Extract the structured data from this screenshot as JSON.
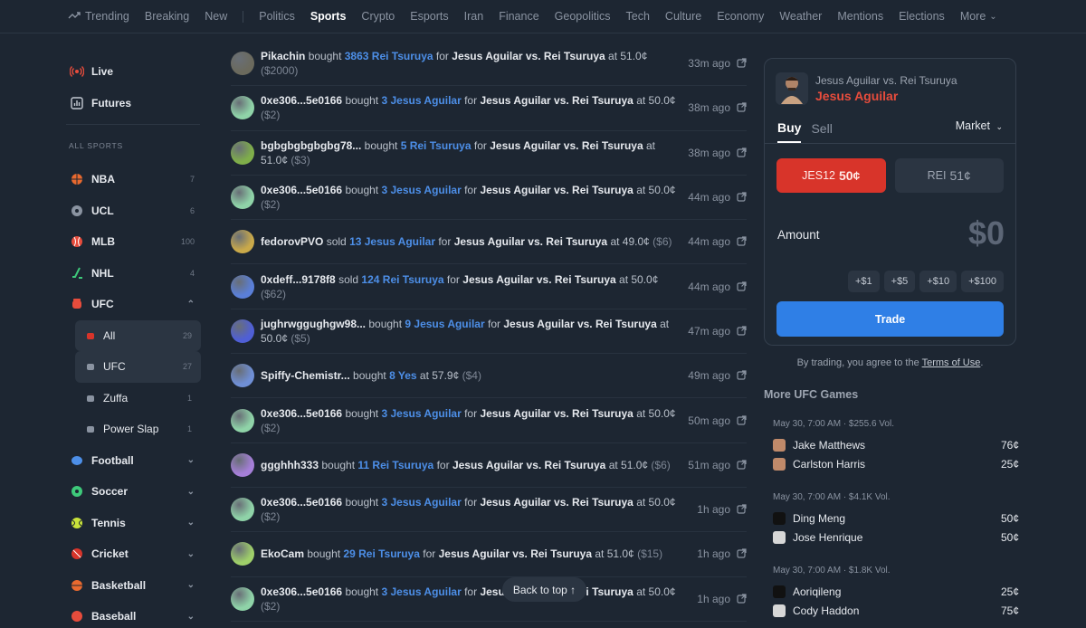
{
  "topnav": {
    "items": [
      "Trending",
      "Breaking",
      "New",
      "Politics",
      "Sports",
      "Crypto",
      "Esports",
      "Iran",
      "Finance",
      "Geopolitics",
      "Tech",
      "Culture",
      "Economy",
      "Weather",
      "Mentions",
      "Elections",
      "More"
    ],
    "active": "Sports"
  },
  "sidebar": {
    "live": "Live",
    "futures": "Futures",
    "heading": "ALL SPORTS",
    "sports": [
      {
        "label": "NBA",
        "count": "7"
      },
      {
        "label": "UCL",
        "count": "6"
      },
      {
        "label": "MLB",
        "count": "100"
      },
      {
        "label": "NHL",
        "count": "4"
      },
      {
        "label": "UFC"
      }
    ],
    "ufc_sub": [
      {
        "label": "All",
        "count": "29"
      },
      {
        "label": "UFC",
        "count": "27"
      },
      {
        "label": "Zuffa",
        "count": "1"
      },
      {
        "label": "Power Slap",
        "count": "1"
      }
    ],
    "more_sports": [
      "Football",
      "Soccer",
      "Tennis",
      "Cricket",
      "Basketball",
      "Baseball"
    ]
  },
  "activity": [
    {
      "user": "Pikachin",
      "verb": "bought",
      "qty": "3863 Rei Tsuruya",
      "mid": "for",
      "market": "Jesus Aguilar vs. Rei Tsuruya",
      "price": "at 51.0¢",
      "amount": "($2000)",
      "time": "33m ago",
      "avatar": "#6b6a5d"
    },
    {
      "user": "0xe306...5e0166",
      "verb": "bought",
      "qty": "3 Jesus Aguilar",
      "mid": "for",
      "market": "Jesus Aguilar vs. Rei Tsuruya",
      "price": "at 50.0¢",
      "amount": "($2)",
      "time": "38m ago",
      "avatar": "#8fd3a8"
    },
    {
      "user": "bgbgbgbgbgbg78...",
      "verb": "bought",
      "qty": "5 Rei Tsuruya",
      "mid": "for",
      "market": "Jesus Aguilar vs. Rei Tsuruya",
      "price": "at 51.0¢",
      "amount": "($3)",
      "time": "38m ago",
      "avatar": "#7fae4a"
    },
    {
      "user": "0xe306...5e0166",
      "verb": "bought",
      "qty": "3 Jesus Aguilar",
      "mid": "for",
      "market": "Jesus Aguilar vs. Rei Tsuruya",
      "price": "at 50.0¢",
      "amount": "($2)",
      "time": "44m ago",
      "avatar": "#8fd3a8"
    },
    {
      "user": "fedorovPVO",
      "verb": "sold",
      "qty": "13 Jesus Aguilar",
      "mid": "for",
      "market": "Jesus Aguilar vs. Rei Tsuruya",
      "price": "at 49.0¢",
      "amount": "($6)",
      "time": "44m ago",
      "avatar": "#c9a94a"
    },
    {
      "user": "0xdeff...9178f8",
      "verb": "sold",
      "qty": "124 Rei Tsuruya",
      "mid": "for",
      "market": "Jesus Aguilar vs. Rei Tsuruya",
      "price": "at 50.0¢",
      "amount": "($62)",
      "time": "44m ago",
      "avatar": "#5a7fd8"
    },
    {
      "user": "jughrwggughgw98...",
      "verb": "bought",
      "qty": "9 Jesus Aguilar",
      "mid": "for",
      "market": "Jesus Aguilar vs. Rei Tsuruya",
      "price": "at 50.0¢",
      "amount": "($5)",
      "time": "47m ago",
      "avatar": "#4f5fd6"
    },
    {
      "user": "Spiffy-Chemistr...",
      "verb": "bought",
      "qty": "8 Yes",
      "mid": "",
      "market": "",
      "price": "at 57.9¢",
      "amount": "($4)",
      "time": "49m ago",
      "avatar": "#6f8fd6"
    },
    {
      "user": "0xe306...5e0166",
      "verb": "bought",
      "qty": "3 Jesus Aguilar",
      "mid": "for",
      "market": "Jesus Aguilar vs. Rei Tsuruya",
      "price": "at 50.0¢",
      "amount": "($2)",
      "time": "50m ago",
      "avatar": "#8fd3a8"
    },
    {
      "user": "ggghhh333",
      "verb": "bought",
      "qty": "11 Rei Tsuruya",
      "mid": "for",
      "market": "Jesus Aguilar vs. Rei Tsuruya",
      "price": "at 51.0¢",
      "amount": "($6)",
      "time": "51m ago",
      "avatar": "#a57fd8"
    },
    {
      "user": "0xe306...5e0166",
      "verb": "bought",
      "qty": "3 Jesus Aguilar",
      "mid": "for",
      "market": "Jesus Aguilar vs. Rei Tsuruya",
      "price": "at 50.0¢",
      "amount": "($2)",
      "time": "1h ago",
      "avatar": "#8fd3a8"
    },
    {
      "user": "EkoCam",
      "verb": "bought",
      "qty": "29 Rei Tsuruya",
      "mid": "for",
      "market": "Jesus Aguilar vs. Rei Tsuruya",
      "price": "at 51.0¢",
      "amount": "($15)",
      "time": "1h ago",
      "avatar": "#9fcf6a"
    },
    {
      "user": "0xe306...5e0166",
      "verb": "bought",
      "qty": "3 Jesus Aguilar",
      "mid": "for",
      "market": "Jesus Aguilar vs. Rei Tsuruya",
      "price": "at 50.0¢",
      "amount": "($2)",
      "time": "1h ago",
      "avatar": "#8fd3a8"
    }
  ],
  "back_to_top": "Back to top ↑",
  "trade": {
    "title": "Jesus Aguilar vs. Rei Tsuruya",
    "pick": "Jesus Aguilar",
    "tab_buy": "Buy",
    "tab_sell": "Sell",
    "mode": "Market",
    "yes_label": "JES12",
    "yes_price": "50¢",
    "no_label": "REI",
    "no_price": "51¢",
    "amount_label": "Amount",
    "amount_value": "$0",
    "quick": [
      "+$1",
      "+$5",
      "+$10",
      "+$100"
    ],
    "button": "Trade",
    "accent": "#d8342a",
    "primary": "#2f7fe6"
  },
  "terms": {
    "prefix": "By trading, you agree to the",
    "link": "Terms of Use",
    "suffix": "."
  },
  "more_games": {
    "title": "More UFC Games",
    "games": [
      {
        "meta": "May 30, 7:00 AM · $255.6 Vol.",
        "f1": "Jake Matthews",
        "p1": "76¢",
        "f2": "Carlston Harris",
        "p2": "25¢"
      },
      {
        "meta": "May 30, 7:00 AM · $4.1K Vol.",
        "f1": "Ding Meng",
        "p1": "50¢",
        "f2": "Jose Henrique",
        "p2": "50¢"
      },
      {
        "meta": "May 30, 7:00 AM · $1.8K Vol.",
        "f1": "Aoriqileng",
        "p1": "25¢",
        "f2": "Cody Haddon",
        "p2": "75¢"
      }
    ]
  }
}
